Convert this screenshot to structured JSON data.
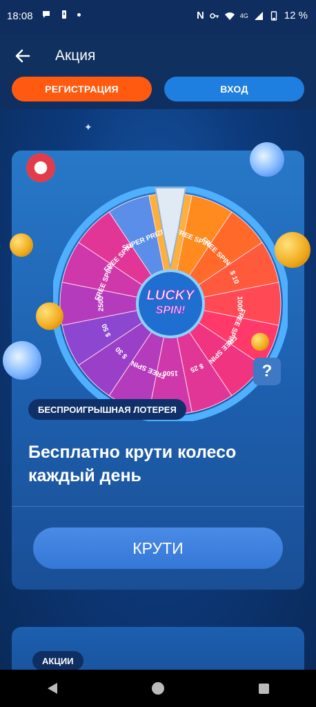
{
  "status_bar": {
    "time": "18:08",
    "network": "4G",
    "battery": "12 %"
  },
  "header": {
    "title": "Акция"
  },
  "auth": {
    "register_label": "РЕГИСТРАЦИЯ",
    "login_label": "ВХОД"
  },
  "promo": {
    "wheel_logo": [
      "LUCKY",
      "SPIN!"
    ],
    "wheel_segments": [
      "100",
      "FREE SPIN 10",
      "FREE SPIN 10",
      "$ 10",
      "1000",
      "FREE SPIN 25",
      "FREE SPIN 20",
      "$ 25",
      "1500",
      "FREE SPIN 50",
      "$ 30",
      "$ 50",
      "2500",
      "FREE SPIN 100",
      "FREE SPIN 50",
      "SUPER PRIZE"
    ],
    "help_label": "?",
    "tag": "БЕСПРОИГРЫШНАЯ ЛОТЕРЕЯ",
    "headline": "Бесплатно крути колесо каждый день",
    "spin_label": "КРУТИ"
  },
  "next_card": {
    "tag": "АКЦИИ"
  },
  "colors": {
    "register": "#ff5a10",
    "login": "#1e7fe0",
    "card": "#2878c8"
  }
}
